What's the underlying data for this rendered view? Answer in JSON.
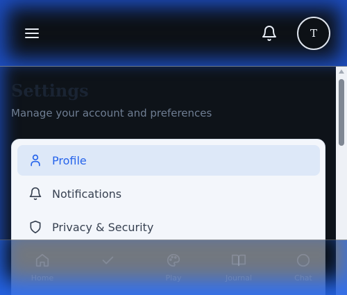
{
  "header": {
    "avatar_initial": "T"
  },
  "page": {
    "title": "Settings",
    "subtitle": "Manage your account and preferences"
  },
  "settings_menu": {
    "items": [
      {
        "label": "Profile",
        "icon": "user-icon",
        "active": true
      },
      {
        "label": "Notifications",
        "icon": "bell-icon",
        "active": false
      },
      {
        "label": "Privacy & Security",
        "icon": "shield-icon",
        "active": false
      }
    ]
  },
  "bottom_nav": {
    "items": [
      {
        "label": "Home",
        "icon": "home-icon"
      },
      {
        "label": "",
        "icon": "check-icon"
      },
      {
        "label": "Play",
        "icon": "palette-icon"
      },
      {
        "label": "Journal",
        "icon": "book-icon"
      },
      {
        "label": "Chat",
        "icon": "chat-icon"
      }
    ]
  },
  "colors": {
    "accent": "#2563eb",
    "glow": "#2a6bff",
    "card_bg": "#f3f6fb"
  }
}
